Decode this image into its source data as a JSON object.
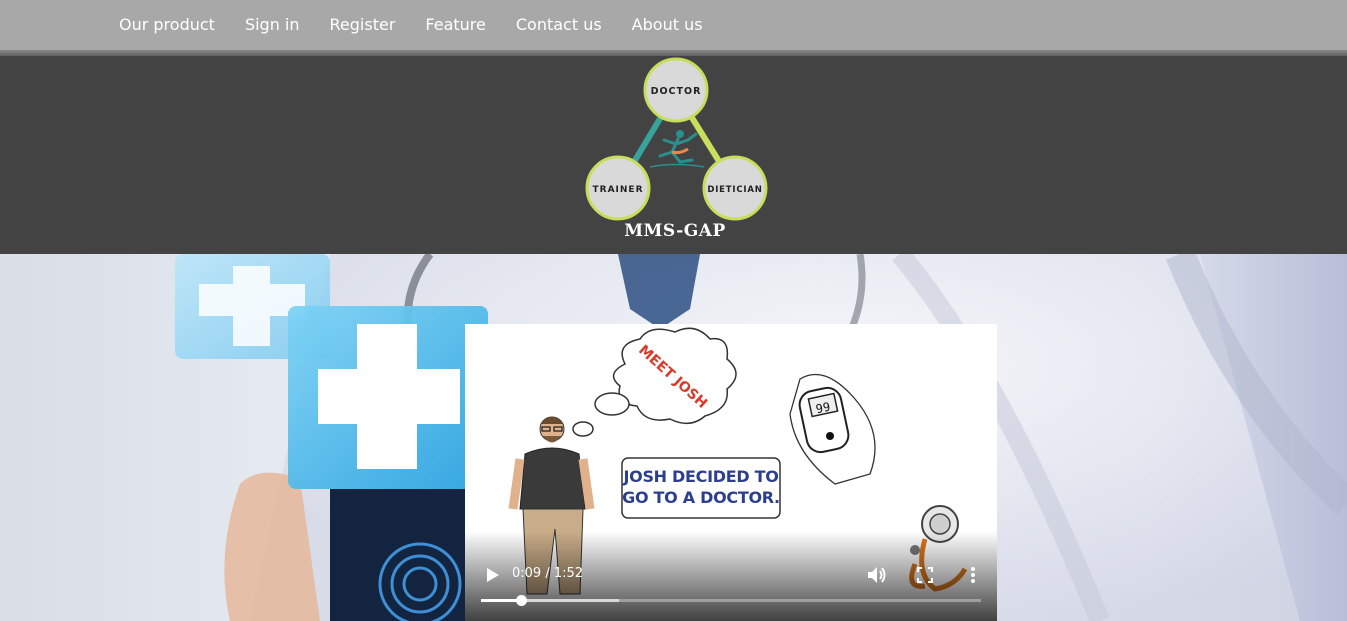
{
  "nav": {
    "items": [
      {
        "label": "Our product"
      },
      {
        "label": "Sign in"
      },
      {
        "label": "Register"
      },
      {
        "label": "Feature"
      },
      {
        "label": "Contact us"
      },
      {
        "label": "About us"
      }
    ]
  },
  "logo": {
    "title": "MMS-GAP",
    "nodes": {
      "top": "DOCTOR",
      "left": "TRAINER",
      "right": "DIETICIAN"
    }
  },
  "video": {
    "thought_text": "MEET JOSH",
    "caption_line1": "JOSH DECIDED TO",
    "caption_line2": "GO TO A DOCTOR.",
    "glucose_reading": "99",
    "current_time": "0:09",
    "duration": "1:52",
    "time_display": "0:09 / 1:52",
    "progress_fraction": 0.08,
    "icons": {
      "play": "play-icon",
      "volume": "volume-icon",
      "fullscreen": "fullscreen-icon",
      "more": "more-options-icon"
    }
  },
  "colors": {
    "nav_bg": "#a8a8a8",
    "header_bg": "#434343",
    "logo_node_fill": "#d9d9d9",
    "logo_node_ring": "#c5df5a",
    "caption_text": "#2c3f8f",
    "thought_text": "#d93a2b"
  }
}
